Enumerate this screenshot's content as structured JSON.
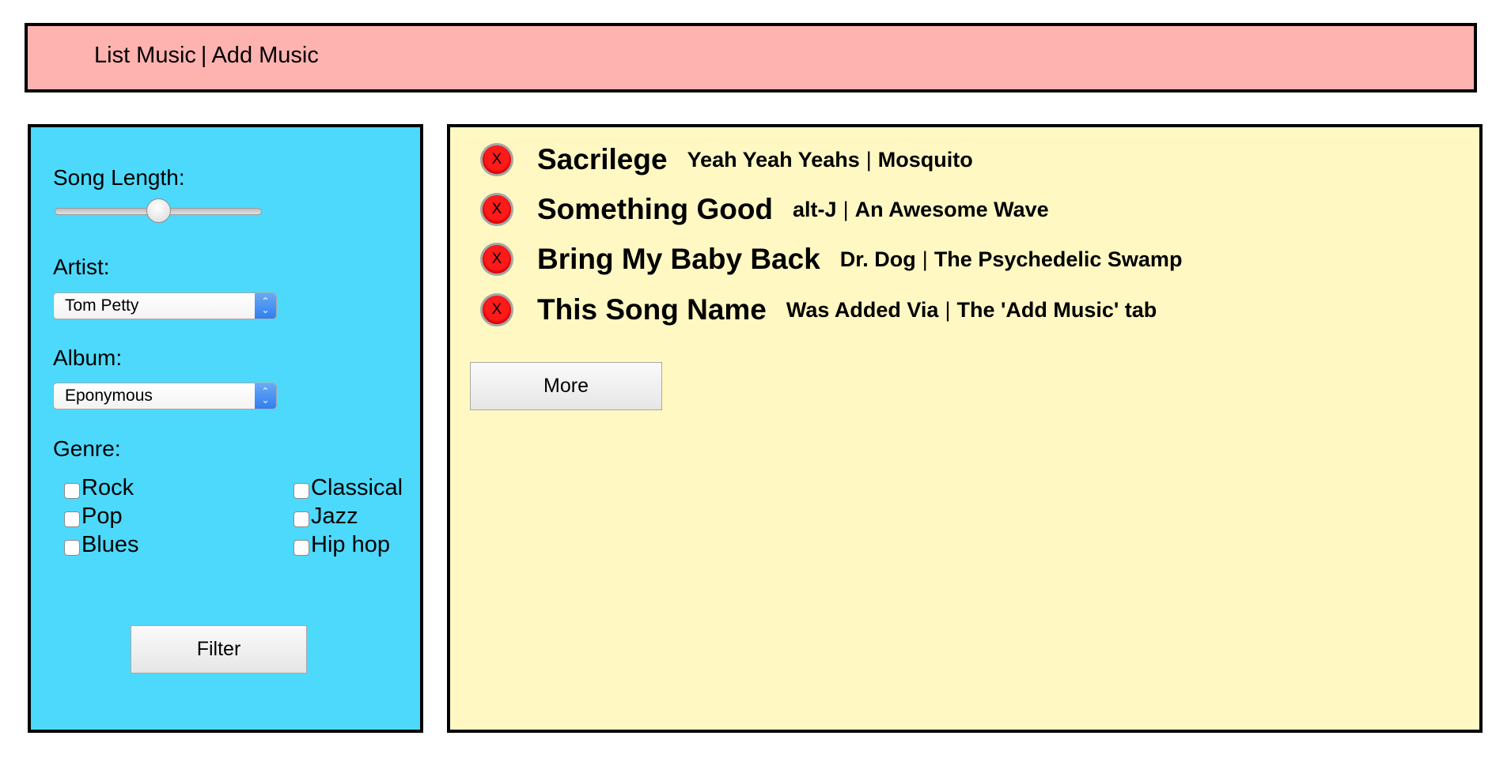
{
  "nav": {
    "list_label": "List Music",
    "separator": "|",
    "add_label": "Add Music"
  },
  "filters": {
    "song_length_label": "Song Length:",
    "song_length_value": 0.5,
    "artist_label": "Artist:",
    "artist_selected": "Tom Petty",
    "album_label": "Album:",
    "album_selected": "Eponymous",
    "genre_label": "Genre:",
    "genres": [
      {
        "label": "Rock",
        "checked": false
      },
      {
        "label": "Pop",
        "checked": false
      },
      {
        "label": "Blues",
        "checked": false
      },
      {
        "label": "Classical",
        "checked": false
      },
      {
        "label": "Jazz",
        "checked": false
      },
      {
        "label": "Hip hop",
        "checked": false
      }
    ],
    "filter_button": "Filter"
  },
  "songs": [
    {
      "delete": "X",
      "title": "Sacrilege",
      "artist": "Yeah Yeah Yeahs",
      "album": "Mosquito"
    },
    {
      "delete": "X",
      "title": "Something Good",
      "artist": "alt-J",
      "album": "An Awesome Wave"
    },
    {
      "delete": "X",
      "title": "Bring My Baby Back",
      "artist": "Dr. Dog",
      "album": "The Psychedelic Swamp"
    },
    {
      "delete": "X",
      "title": "This Song Name",
      "artist": "Was Added Via",
      "album": "The 'Add Music' tab"
    }
  ],
  "more_button": "More",
  "colors": {
    "nav_bg": "#ffb3b0",
    "sidebar_bg": "#4dd9fb",
    "main_bg": "#fff8c2",
    "delete_red": "#ff1a1a"
  }
}
